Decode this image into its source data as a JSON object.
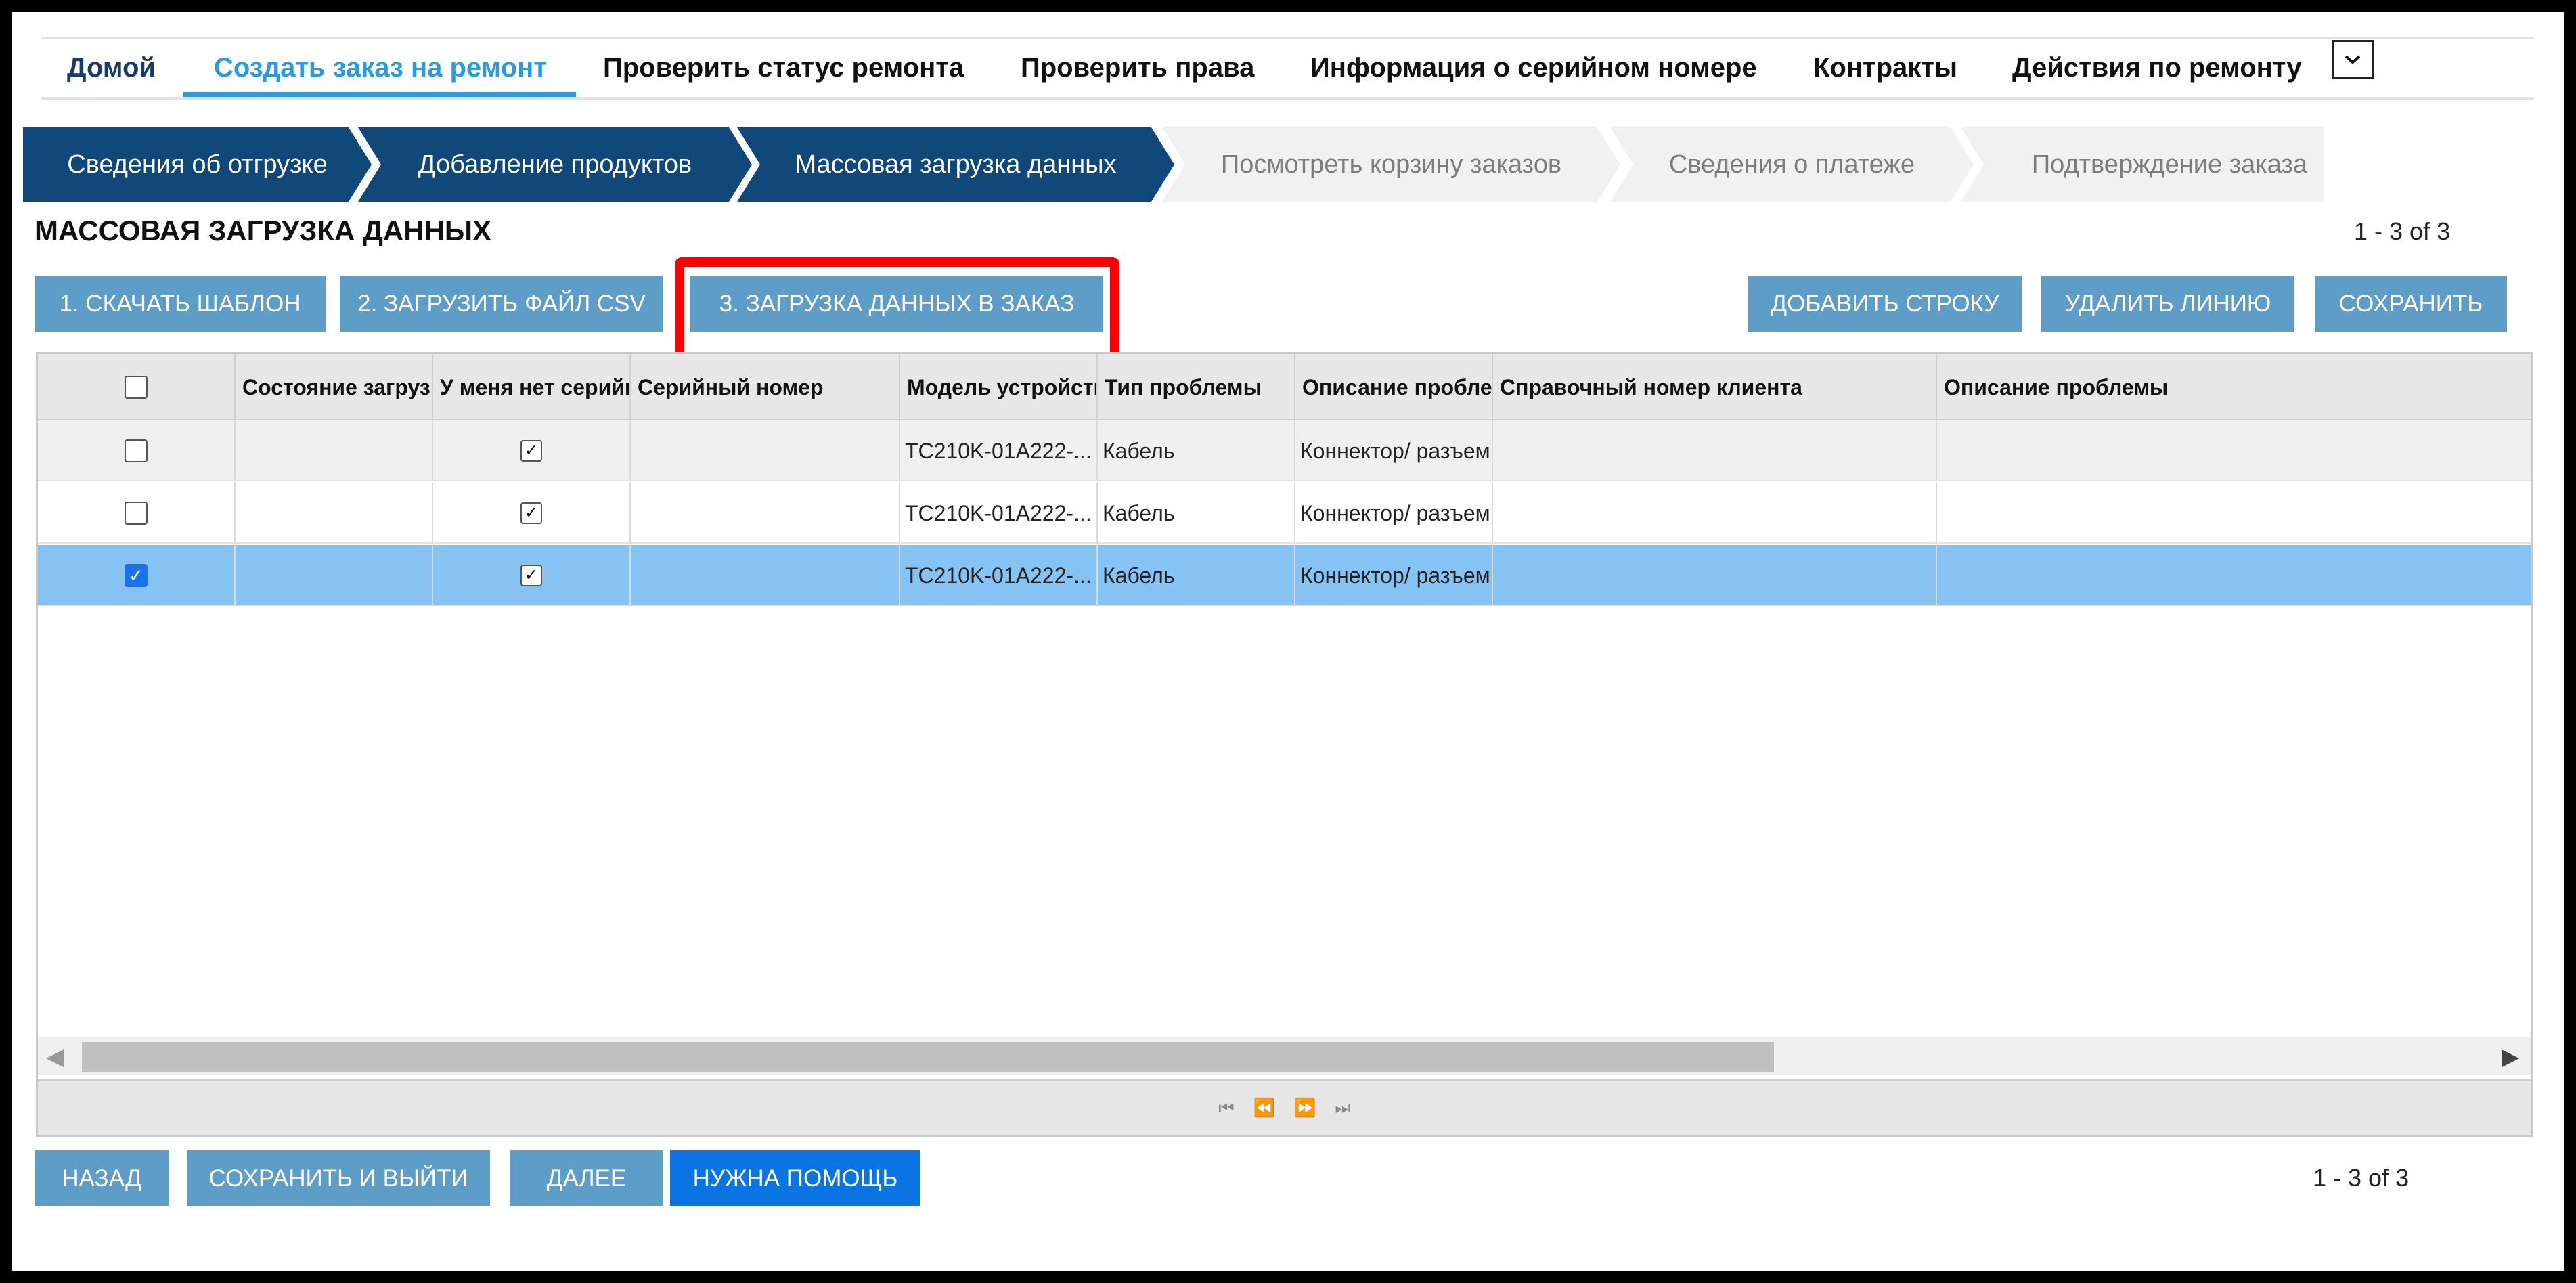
{
  "nav": {
    "items": [
      "Домой",
      "Создать заказ на ремонт",
      "Проверить статус ремонта",
      "Проверить права",
      "Информация о серийном номере",
      "Контракты",
      "Действия по ремонту"
    ],
    "more_icon": "chevron-down-icon"
  },
  "steps": [
    "Сведения об отгрузке",
    "Добавление продуктов",
    "Массовая загрузка данных",
    "Посмотреть корзину заказов",
    "Сведения о платеже",
    "Подтверждение заказа"
  ],
  "page_title": "МАССОВАЯ ЗАГРУЗКА ДАННЫХ",
  "pager_top": "1 - 3 of 3",
  "pager_bottom": "1 - 3 of 3",
  "actions": {
    "download_template": "1. СКАЧАТЬ ШАБЛОН",
    "upload_csv": "2. ЗАГРУЗИТЬ ФАЙЛ CSV",
    "load_to_order": "3. ЗАГРУЗКА ДАННЫХ В ЗАКАЗ",
    "add_row": "ДОБАВИТЬ СТРОКУ",
    "delete_line": "УДАЛИТЬ ЛИНИЮ",
    "save": "СОХРАНИТЬ"
  },
  "grid": {
    "columns": [
      "Состояние загрузки",
      "У меня нет серийного номера",
      "Серийный номер",
      "Модель устройства",
      "Тип проблемы",
      "Описание проблемы",
      "Справочный номер клиента",
      "Описание проблемы"
    ],
    "rows": [
      {
        "selected": false,
        "status": "",
        "no_serial": true,
        "serial": "",
        "model": "TC210K-01A222-...",
        "problem_type": "Кабель",
        "problem_desc": "Коннектор/ разъем",
        "customer_ref": "",
        "description": ""
      },
      {
        "selected": false,
        "status": "",
        "no_serial": true,
        "serial": "",
        "model": "TC210K-01A222-...",
        "problem_type": "Кабель",
        "problem_desc": "Коннектор/ разъем",
        "customer_ref": "",
        "description": ""
      },
      {
        "selected": true,
        "status": "",
        "no_serial": true,
        "serial": "",
        "model": "TC210K-01A222-...",
        "problem_type": "Кабель",
        "problem_desc": "Коннектор/ разъем",
        "customer_ref": "",
        "description": ""
      }
    ]
  },
  "bottom": {
    "back": "НАЗАД",
    "save_exit": "СОХРАНИТЬ И ВЫЙТИ",
    "next": "ДАЛЕЕ",
    "help": "НУЖНА ПОМОЩЬ"
  },
  "colors": {
    "nav_active": "#2a9be0",
    "step_done": "#10487a",
    "button": "#5d9dc7",
    "help_button": "#0a74e2",
    "selected_row": "#86c2f2",
    "highlight": "#ff0000"
  }
}
